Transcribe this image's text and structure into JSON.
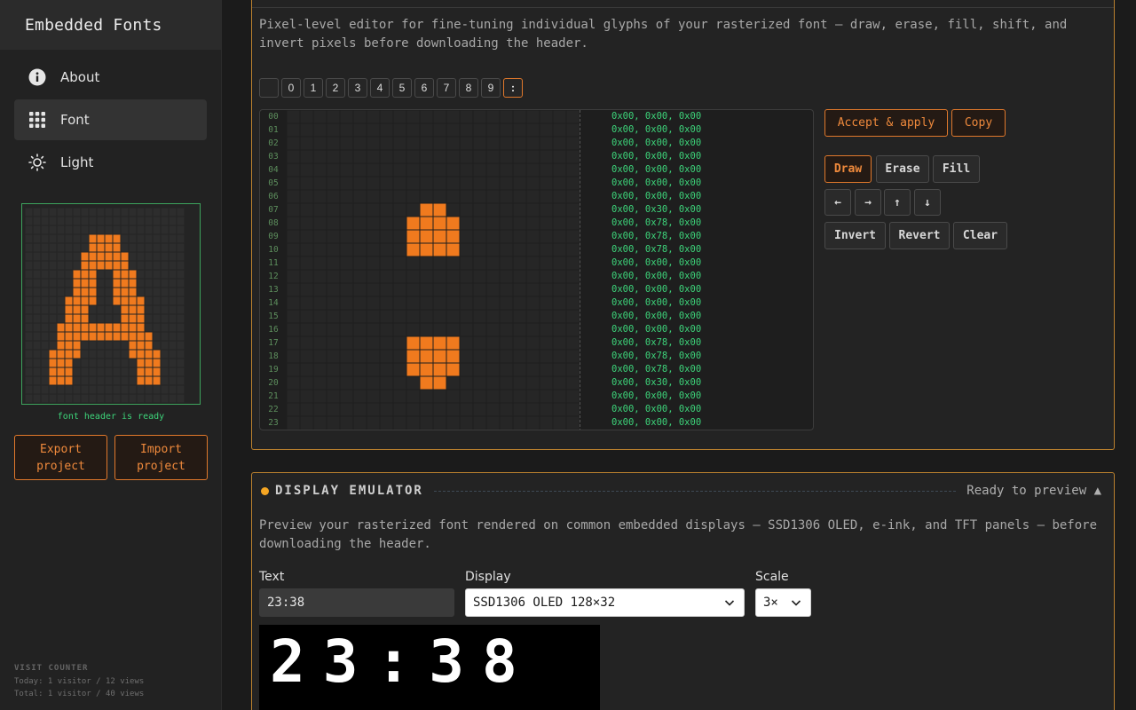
{
  "app": {
    "title": "Embedded Fonts"
  },
  "sidebar": {
    "items": [
      {
        "label": "About",
        "icon": "info-icon"
      },
      {
        "label": "Font",
        "icon": "grid-icon",
        "active": true
      },
      {
        "label": "Light",
        "icon": "sun-icon"
      }
    ],
    "preview_glyph": "A",
    "status": "font header is ready",
    "export_label": "Export project",
    "import_label": "Import project",
    "visit_counter": {
      "title": "VISIT COUNTER",
      "today": "Today: 1 visitor / 12 views",
      "total": "Total: 1 visitor / 40 views"
    }
  },
  "editor": {
    "description": "Pixel-level editor for fine-tuning individual glyphs of your rasterized font — draw, erase, fill, shift, and invert pixels before downloading the header.",
    "glyph_tabs": [
      " ",
      "0",
      "1",
      "2",
      "3",
      "4",
      "5",
      "6",
      "7",
      "8",
      "9",
      ":"
    ],
    "active_glyph": ":",
    "row_numbers": [
      "00",
      "01",
      "02",
      "03",
      "04",
      "05",
      "06",
      "07",
      "08",
      "09",
      "10",
      "11",
      "12",
      "13",
      "14",
      "15",
      "16",
      "17",
      "18",
      "19",
      "20",
      "21",
      "22",
      "23"
    ],
    "hex_rows": [
      "0x00, 0x00, 0x00",
      "0x00, 0x00, 0x00",
      "0x00, 0x00, 0x00",
      "0x00, 0x00, 0x00",
      "0x00, 0x00, 0x00",
      "0x00, 0x00, 0x00",
      "0x00, 0x00, 0x00",
      "0x00, 0x30, 0x00",
      "0x00, 0x78, 0x00",
      "0x00, 0x78, 0x00",
      "0x00, 0x78, 0x00",
      "0x00, 0x00, 0x00",
      "0x00, 0x00, 0x00",
      "0x00, 0x00, 0x00",
      "0x00, 0x00, 0x00",
      "0x00, 0x00, 0x00",
      "0x00, 0x00, 0x00",
      "0x00, 0x78, 0x00",
      "0x00, 0x78, 0x00",
      "0x00, 0x78, 0x00",
      "0x00, 0x30, 0x00",
      "0x00, 0x00, 0x00",
      "0x00, 0x00, 0x00",
      "0x00, 0x00, 0x00"
    ],
    "buttons": {
      "accept": "Accept & apply",
      "copy": "Copy",
      "draw": "Draw",
      "erase": "Erase",
      "fill": "Fill",
      "arrow_left": "←",
      "arrow_right": "→",
      "arrow_up": "↑",
      "arrow_down": "↓",
      "invert": "Invert",
      "revert": "Revert",
      "clear": "Clear"
    },
    "active_tool": "draw"
  },
  "emulator": {
    "title": "DISPLAY EMULATOR",
    "status": "Ready to preview ▲",
    "description": "Preview your rasterized font rendered on common embedded displays — SSD1306 OLED, e-ink, and TFT panels — before downloading the header.",
    "text_label": "Text",
    "text_value": "23:38",
    "display_label": "Display",
    "display_value": "SSD1306 OLED 128×32",
    "scale_label": "Scale",
    "scale_value": "3×"
  },
  "colors": {
    "accent": "#f08a3c",
    "pixel_on": "#f07a1e",
    "hex_text": "#3dd47a",
    "panel_border": "#b9802e"
  }
}
